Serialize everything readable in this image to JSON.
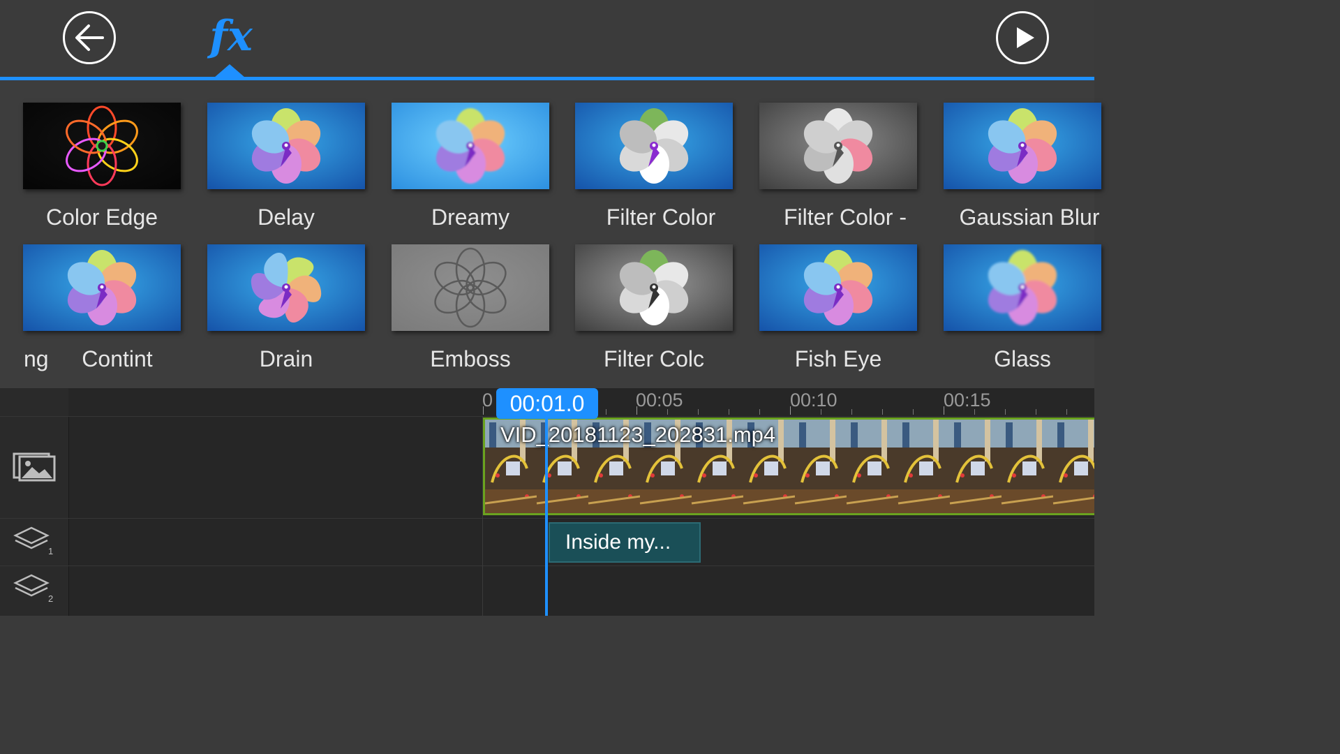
{
  "toolbar": {
    "back_icon": "arrow-left-icon",
    "fx_label": "fx",
    "play_icon": "play-icon"
  },
  "effects": {
    "row1": [
      {
        "label": "Color Edge",
        "style": "edge"
      },
      {
        "label": "Delay",
        "style": "normal"
      },
      {
        "label": "Dreamy",
        "style": "dreamy"
      },
      {
        "label": "Filter Color",
        "style": "filter1"
      },
      {
        "label": "Filter Color -",
        "style": "filter2"
      },
      {
        "label": "Gaussian Blur",
        "style": "normal"
      }
    ],
    "row2": [
      {
        "label": "Contint",
        "prefix": "ng",
        "style": "normal"
      },
      {
        "label": "Drain",
        "style": "drain"
      },
      {
        "label": "Emboss",
        "style": "emboss"
      },
      {
        "label": "Filter Colc",
        "style": "filter3"
      },
      {
        "label": "Fish Eye",
        "style": "normal"
      },
      {
        "label": "Glass",
        "style": "glass"
      }
    ]
  },
  "timeline": {
    "current_time": "00:01.0",
    "ticks": [
      "0",
      "00:05",
      "00:10",
      "00:15"
    ],
    "video_clip_name": "VID_20181123_202831.mp4",
    "text_clip_label": "Inside my...",
    "tracks": [
      {
        "icon": "video-track-icon"
      },
      {
        "icon": "layer-1-icon",
        "number": "1"
      },
      {
        "icon": "layer-2-icon",
        "number": "2"
      }
    ]
  },
  "colors": {
    "accent": "#1e90ff",
    "clip_border": "#6aa31f",
    "text_clip": "#1a4f57"
  }
}
